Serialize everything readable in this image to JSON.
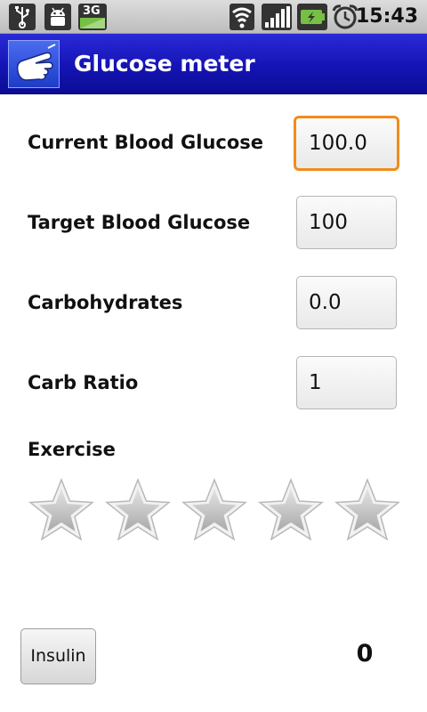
{
  "status_bar": {
    "time": "15:43",
    "network_type": "3G",
    "icons": [
      "usb-icon",
      "android-debug-icon",
      "3g-icon",
      "wifi-icon",
      "signal-icon",
      "battery-charging-icon",
      "alarm-clock-icon"
    ]
  },
  "app": {
    "title": "Glucose meter",
    "icon": "pointing-hand-icon"
  },
  "form": {
    "current_label": "Current Blood Glucose",
    "current_value": "100.0",
    "target_label": "Target Blood Glucose",
    "target_value": "100",
    "carbs_label": "Carbohydrates",
    "carbs_value": "0.0",
    "ratio_label": "Carb Ratio",
    "ratio_value": "1"
  },
  "exercise": {
    "label": "Exercise",
    "rating": 0,
    "max_rating": 5
  },
  "footer": {
    "insulin_label": "Insulin",
    "result_value": "0"
  },
  "colors": {
    "title_bar": "#1414b4",
    "focus_border": "#f08c1e",
    "star_fill": "#cfcfcf"
  }
}
